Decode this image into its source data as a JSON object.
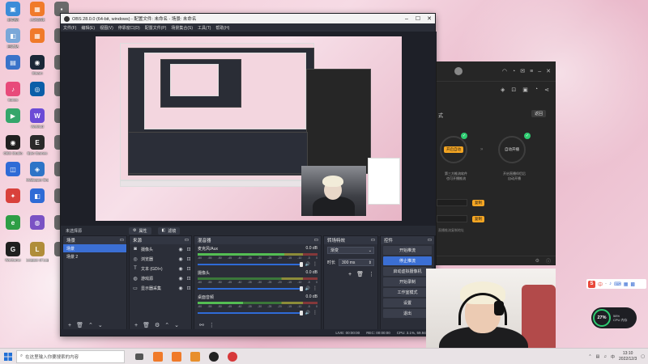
{
  "desktop": {
    "icons": [
      {
        "label": "此电脑",
        "color": "#3b8cd8",
        "glyph": "▣"
      },
      {
        "label": "心的游戏",
        "color": "#f07a2a",
        "glyph": "▦"
      },
      {
        "label": "",
        "color": "#6a6a6a",
        "glyph": "▪"
      },
      {
        "label": "回收站",
        "color": "#7aa7d8",
        "glyph": "◧"
      },
      {
        "label": "",
        "color": "#f07a2a",
        "glyph": "▦"
      },
      {
        "label": "",
        "color": "#6a6a6a",
        "glyph": "▪"
      },
      {
        "label": "",
        "color": "#3a73c9",
        "glyph": "▤"
      },
      {
        "label": "Steam",
        "color": "#1b2838",
        "glyph": "◉"
      },
      {
        "label": "",
        "color": "#6a6a6a",
        "glyph": "▪"
      },
      {
        "label": "Itunes",
        "color": "#e84a7a",
        "glyph": "♪"
      },
      {
        "label": "",
        "color": "#0b5ea8",
        "glyph": "◎"
      },
      {
        "label": "",
        "color": "#6a6a6a",
        "glyph": "▪"
      },
      {
        "label": "",
        "color": "#35a66b",
        "glyph": "▶"
      },
      {
        "label": "WeMod",
        "color": "#6c4bd6",
        "glyph": "W"
      },
      {
        "label": "",
        "color": "#6a6a6a",
        "glyph": "▪"
      },
      {
        "label": "OBS Studio",
        "color": "#202020",
        "glyph": "◉"
      },
      {
        "label": "Epic Games",
        "color": "#2a2a2a",
        "glyph": "E"
      },
      {
        "label": "",
        "color": "#6a6a6a",
        "glyph": "▪"
      },
      {
        "label": "",
        "color": "#2f6bd6",
        "glyph": "◫"
      },
      {
        "label": "Wallpaper Engine",
        "color": "#2d74c7",
        "glyph": "◈"
      },
      {
        "label": "",
        "color": "#6a6a6a",
        "glyph": "▪"
      },
      {
        "label": "",
        "color": "#d9413b",
        "glyph": "✦"
      },
      {
        "label": "",
        "color": "#2f6bd6",
        "glyph": "◧"
      },
      {
        "label": "",
        "color": "#6a6a6a",
        "glyph": "▪"
      },
      {
        "label": "",
        "color": "#2e9e45",
        "glyph": "e"
      },
      {
        "label": "",
        "color": "#7a52c4",
        "glyph": "◍"
      },
      {
        "label": "",
        "color": "#6a6a6a",
        "glyph": "▪"
      },
      {
        "label": "WeGame",
        "color": "#1f1f1f",
        "glyph": "G"
      },
      {
        "label": "League of Legends",
        "color": "#b08d3a",
        "glyph": "L"
      },
      {
        "label": "",
        "color": "#6a6a6a",
        "glyph": "▪"
      }
    ]
  },
  "obs": {
    "title": "OBS 28.0.0 (64-bit, windows) - 配置文件: 未命名 - 场景: 未命名",
    "menu": [
      "文件(F)",
      "编辑(E)",
      "视图(V)",
      "停靠窗口(D)",
      "配置文件(P)",
      "场景集合(S)",
      "工具(T)",
      "帮助(H)"
    ],
    "status_source": "未选择源",
    "properties_btn": "属性",
    "filters_btn": "滤镜",
    "scenes": {
      "title": "场景",
      "items": [
        "场景",
        "场景 2"
      ]
    },
    "sources": {
      "title": "来源",
      "items": [
        "摄像头",
        "浏览器",
        "文本 (GDI+)",
        "游戏源",
        "显示器采集"
      ]
    },
    "mixer": {
      "title": "混音器",
      "channels": [
        {
          "name": "麦克风/Aux",
          "db": "0.0 dB",
          "level": 0.72
        },
        {
          "name": "摄像头",
          "db": "0.0 dB",
          "level": 0.0
        },
        {
          "name": "桌面音频",
          "db": "0.0 dB",
          "level": 0.38
        }
      ],
      "scale": [
        "-60",
        "-55",
        "-50",
        "-45",
        "-40",
        "-35",
        "-30",
        "-25",
        "-20",
        "-15",
        "-10",
        "-5",
        "0"
      ]
    },
    "transitions": {
      "title": "转场特效",
      "type": "渐变",
      "duration_label": "时长",
      "duration": "300 ms"
    },
    "controls": {
      "title": "控件",
      "buttons": [
        "开始推流",
        "停止推流",
        "启动虚拟摄像机",
        "开始录制",
        "工作室模式",
        "设置",
        "退出"
      ]
    },
    "statusbar": {
      "live": "LIVE: 00:00:00",
      "rec": "REC: 00:00:00",
      "cpu": "CPU: 3.1%, 59.94 fps"
    }
  },
  "right_app": {
    "section_label": "式",
    "back_btn": "返回",
    "left_ring_text": "开启自动",
    "right_ring_text": "自动开播",
    "left_desc": "第三方推流软件\n也可开播推流",
    "right_desc": "开启直播伴侣后\n自动开播",
    "orange_btn_1": "复制",
    "orange_btn_2": "复制",
    "footer_text": "直播推流复制地址"
  },
  "widgets": {
    "cpu_percent": "27%",
    "cpu_line1": "58%",
    "cpu_line2": "CPU 内存",
    "ime": "中"
  },
  "taskbar": {
    "search_placeholder": "在这里输入你要搜索的内容",
    "time": "13:10",
    "date": "2022/12/3"
  }
}
